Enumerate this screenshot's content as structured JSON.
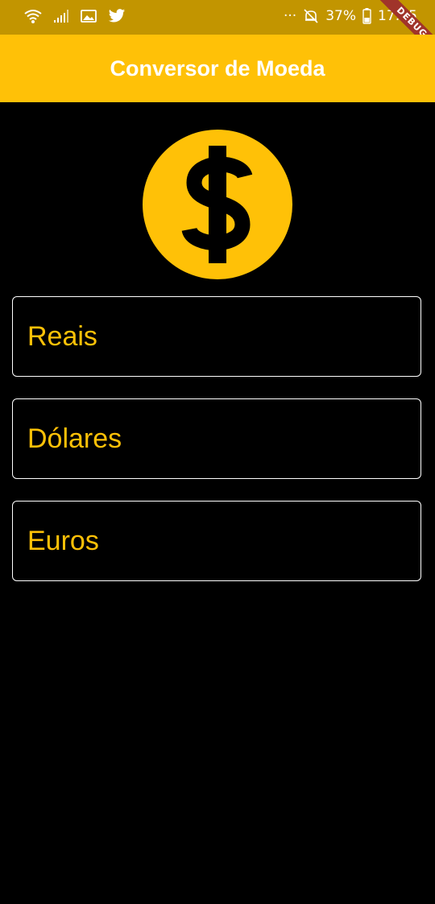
{
  "status_bar": {
    "battery": "37%",
    "time": "17:35",
    "more_indicator": "···",
    "icons": [
      "wifi-icon",
      "signal-icon",
      "image-icon",
      "twitter-icon",
      "mute-icon",
      "battery-icon"
    ]
  },
  "debug_banner": "DEBUG",
  "app_bar": {
    "title": "Conversor de Moeda"
  },
  "logo": {
    "icon": "dollar-coin-icon"
  },
  "fields": {
    "reais": {
      "label": "Reais",
      "value": ""
    },
    "dolares": {
      "label": "Dólares",
      "value": ""
    },
    "euros": {
      "label": "Euros",
      "value": ""
    }
  },
  "colors": {
    "accent": "#FFC107",
    "status_bar": "#C29500",
    "background": "#000000",
    "border": "#FFFFFF"
  }
}
